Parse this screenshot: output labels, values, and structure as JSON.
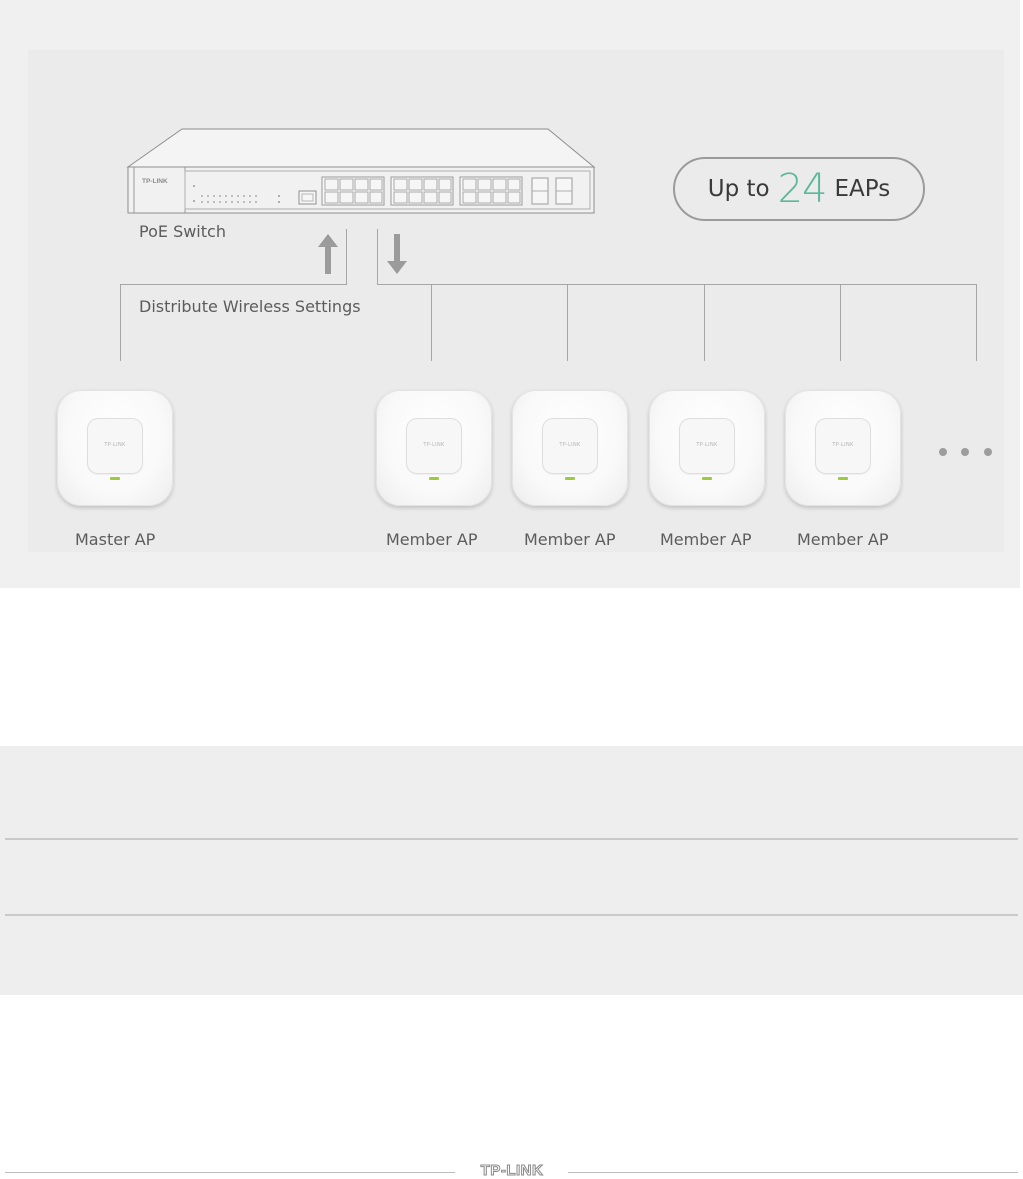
{
  "diagram": {
    "switch": {
      "brand": "TP-LINK",
      "label": "PoE Switch"
    },
    "distribute_label": "Distribute Wireless Settings",
    "capacity": {
      "prefix": "Up to",
      "count": "24",
      "suffix": "EAPs"
    },
    "access_points": [
      {
        "label": "Master AP",
        "brand": "TP-LINK"
      },
      {
        "label": "Member AP",
        "brand": "TP-LINK"
      },
      {
        "label": "Member AP",
        "brand": "TP-LINK"
      },
      {
        "label": "Member AP",
        "brand": "TP-LINK"
      },
      {
        "label": "Member AP",
        "brand": "TP-LINK"
      }
    ]
  },
  "footer": {
    "logo": "TP-LINK"
  },
  "colors": {
    "accent_number": "#5cb89a",
    "led_green": "#9ccc3e",
    "band_gray": "#f0f0f1"
  }
}
